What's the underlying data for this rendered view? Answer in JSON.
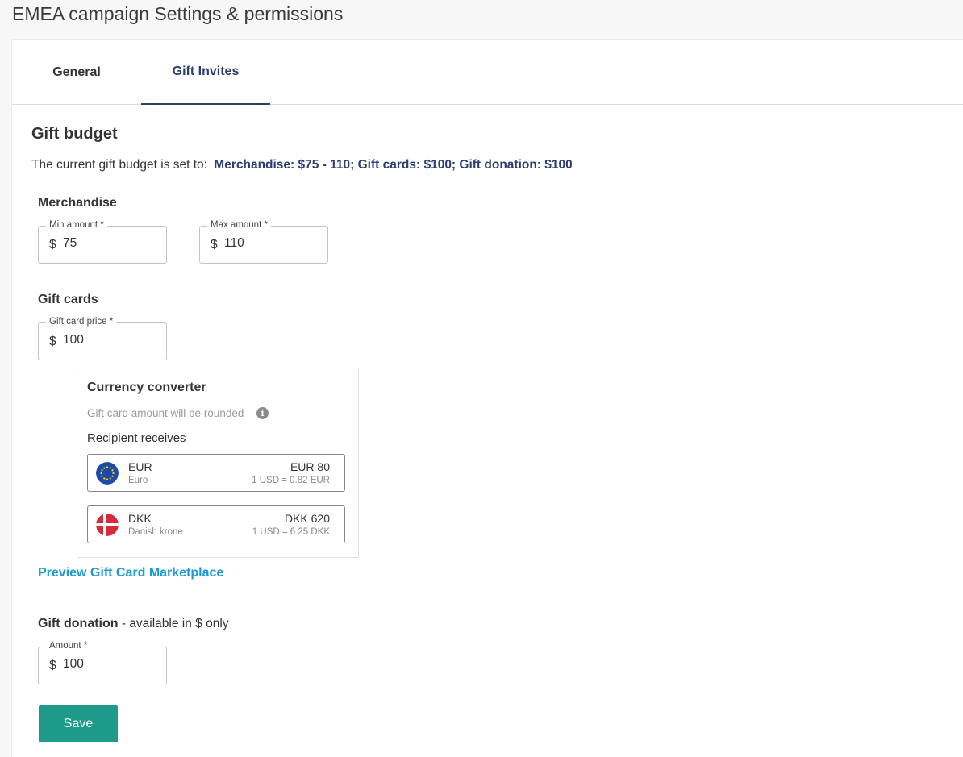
{
  "page": {
    "title": "EMEA campaign Settings & permissions"
  },
  "tabs": [
    {
      "label": "General"
    },
    {
      "label": "Gift Invites"
    }
  ],
  "gift_budget": {
    "heading": "Gift budget",
    "current_prefix": "The current gift budget is set to:",
    "current_value": "Merchandise: $75 - 110; Gift cards: $100; Gift donation: $100"
  },
  "merchandise": {
    "label": "Merchandise",
    "min": {
      "legend": "Min amount *",
      "prefix": "$",
      "value": "75"
    },
    "max": {
      "legend": "Max amount *",
      "prefix": "$",
      "value": "110"
    }
  },
  "gift_cards": {
    "label": "Gift cards",
    "price": {
      "legend": "Gift card price *",
      "prefix": "$",
      "value": "100"
    }
  },
  "converter": {
    "title": "Currency converter",
    "note": "Gift card amount will be rounded",
    "info_icon": "info-icon",
    "recipient_label": "Recipient receives",
    "currencies": [
      {
        "code": "EUR",
        "name": "Euro",
        "amount": "EUR 80",
        "rate": "1 USD = 0.82 EUR",
        "flag": "eu-flag-icon"
      },
      {
        "code": "DKK",
        "name": "Danish krone",
        "amount": "DKK 620",
        "rate": "1 USD = 6.25 DKK",
        "flag": "denmark-flag-icon"
      }
    ]
  },
  "preview_link": "Preview Gift Card Marketplace",
  "donation": {
    "label": "Gift donation",
    "suffix": " - available in $ only",
    "amount": {
      "legend": "Amount *",
      "prefix": "$",
      "value": "100"
    }
  },
  "save_label": "Save",
  "colors": {
    "accent": "#2c3e6e",
    "link": "#1a9ad6",
    "save": "#1e9a8a"
  }
}
